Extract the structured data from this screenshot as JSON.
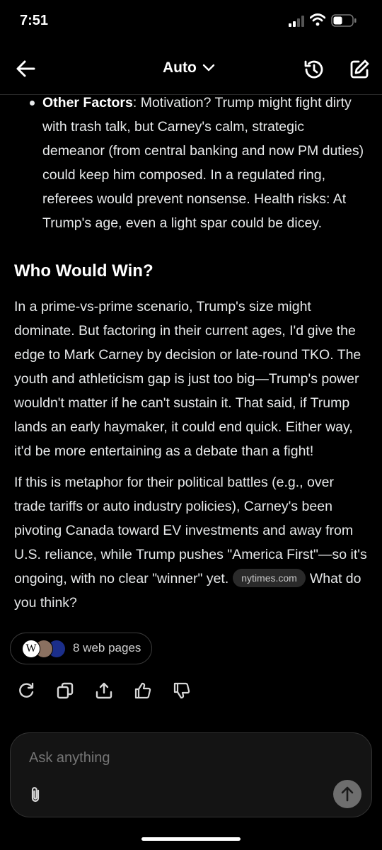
{
  "status_bar": {
    "time": "7:51"
  },
  "header": {
    "model_label": "Auto"
  },
  "message": {
    "bullet": {
      "title": "Other Factors",
      "text": ": Motivation? Trump might fight dirty with trash talk, but Carney's calm, strategic demeanor (from central banking and now PM duties) could keep him composed. In a regulated ring, referees would prevent nonsense. Health risks: At Trump's age, even a light spar could be dicey."
    },
    "heading": "Who Would Win?",
    "paragraph1": "In a prime-vs-prime scenario, Trump's size might dominate. But factoring in their current ages, I'd give the edge to Mark Carney by decision or late-round TKO. The youth and athleticism gap is just too big—Trump's power wouldn't matter if he can't sustain it. That said, if Trump lands an early haymaker, it could end quick. Either way, it'd be more entertaining as a debate than a fight!",
    "paragraph2_before": "If this is metaphor for their political battles (e.g., over trade tariffs or auto industry policies), Carney's been pivoting Canada toward EV investments and away from U.S. reliance, while Trump pushes \"America First\"—so it's ongoing, with no clear \"winner\" yet.",
    "source_chip": "nytimes.com",
    "paragraph2_after": "What do you think?"
  },
  "sources": {
    "label": "8 web pages",
    "favicons": [
      "W",
      "portrait",
      "navy"
    ]
  },
  "actions": [
    "regenerate-icon",
    "copy-icon",
    "share-icon",
    "thumbs-up-icon",
    "thumbs-down-icon"
  ],
  "composer": {
    "placeholder": "Ask anything"
  },
  "colors": {
    "background": "#000000",
    "text": "#e7e9ea",
    "chip": "#2a2a2a",
    "send_button": "#6e6e6e"
  }
}
